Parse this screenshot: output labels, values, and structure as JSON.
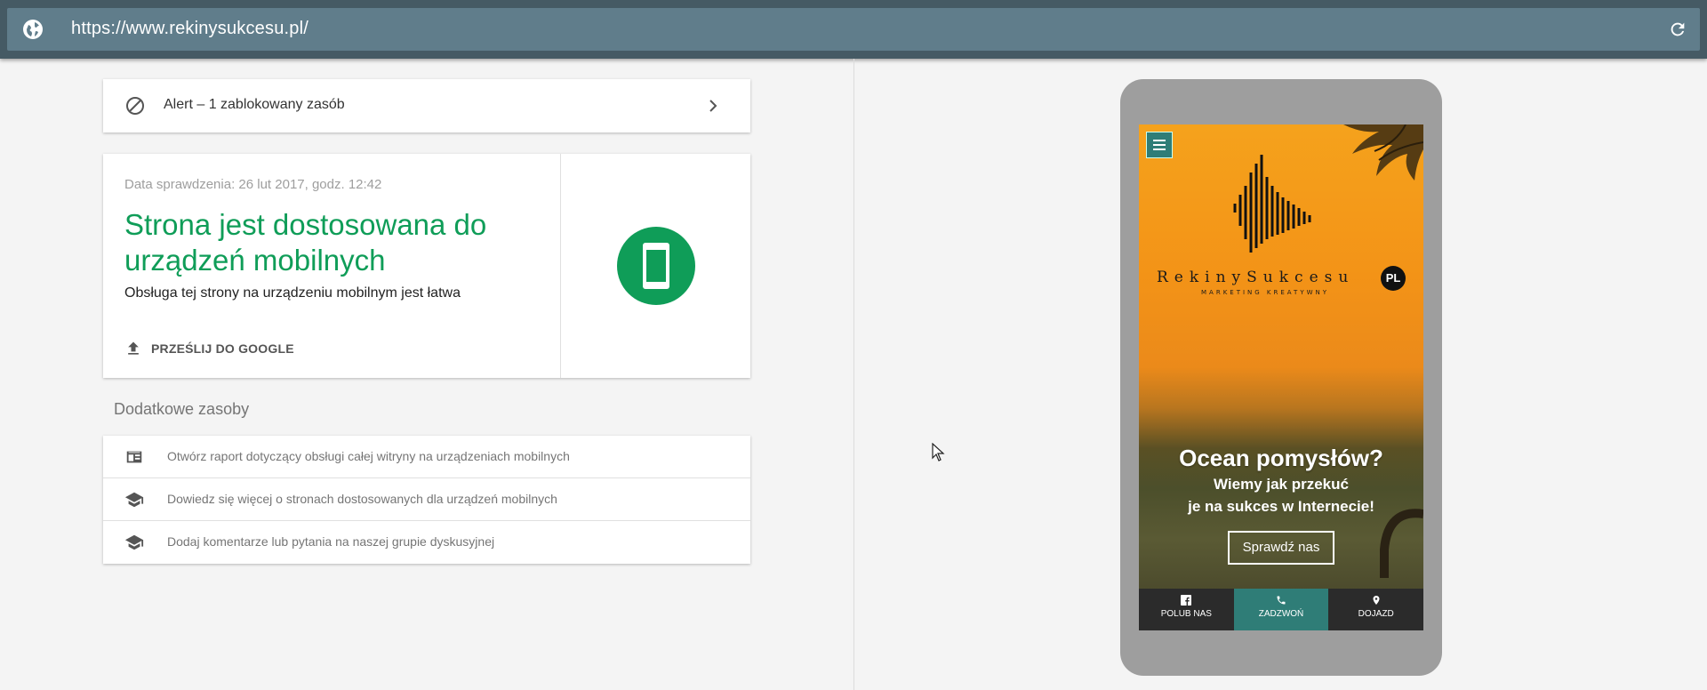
{
  "address_bar": {
    "url": "https://www.rekinysukcesu.pl/",
    "globe_icon": "globe-icon",
    "reload_icon": "reload-icon"
  },
  "alert": {
    "label": "Alert – 1 zablokowany zasób",
    "icon": "blocked-icon",
    "chevron": "chevron-right-icon"
  },
  "result": {
    "date": "Data sprawdzenia: 26 lut 2017, godz. 12:42",
    "headline": "Strona jest dostosowana do urządzeń mobilnych",
    "description": "Obsługa tej strony na urządzeniu mobilnym jest łatwa",
    "submit_label": "PRZEŚLIJ DO GOOGLE",
    "accent_color": "#0f9d58"
  },
  "extra_resources": {
    "title": "Dodatkowe zasoby",
    "items": [
      {
        "label": "Otwórz raport dotyczący obsługi całej witryny na urządzeniach mobilnych",
        "icon": "report-icon"
      },
      {
        "label": "Dowiedz się więcej o stronach dostosowanych dla urządzeń mobilnych",
        "icon": "school-icon"
      },
      {
        "label": "Dodaj komentarze lub pytania na naszej grupie dyskusyjnej",
        "icon": "school-icon"
      }
    ]
  },
  "preview": {
    "logo_text": "RekinySukcesu",
    "logo_badge": "PL",
    "logo_tagline": "MARKETING KREATYWNY",
    "hero_title": "Ocean pomysłów?",
    "hero_line1": "Wiemy jak przekuć",
    "hero_line2": "je na sukces w Internecie!",
    "cta_label": "Sprawdź nas",
    "bottom_bar": [
      {
        "label": "POLUB NAS",
        "icon": "facebook-icon"
      },
      {
        "label": "ZADZWOŃ",
        "icon": "phone-icon"
      },
      {
        "label": "DOJAZD",
        "icon": "map-pin-icon"
      }
    ],
    "accent_color": "#2f7d77"
  }
}
